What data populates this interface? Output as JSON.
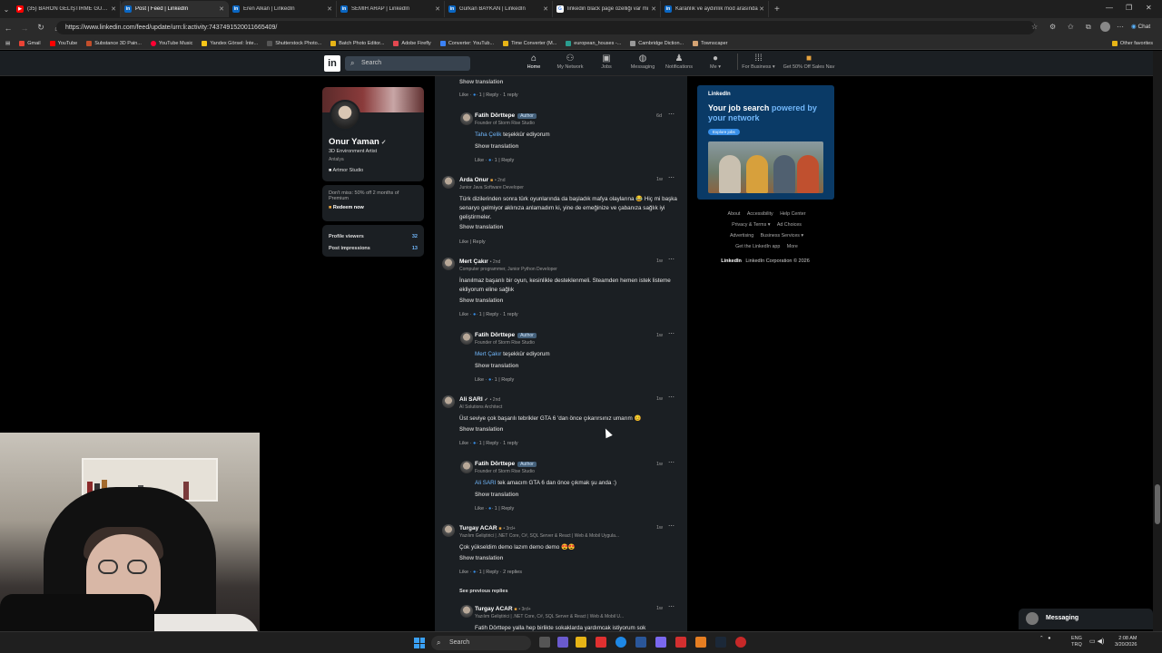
{
  "browser": {
    "tabs": [
      {
        "label": "(35) BARON GELİŞTİRME GÜNLÜĞ",
        "icon": "youtube-icon",
        "color": "#ff0000",
        "active": false
      },
      {
        "label": "Post | Feed | LinkedIn",
        "icon": "linkedin-icon",
        "color": "#0a66c2",
        "active": true
      },
      {
        "label": "Eren Alkan | LinkedIn",
        "icon": "linkedin-icon",
        "color": "#0a66c2",
        "active": false
      },
      {
        "label": "SEMİH ARAP | LinkedIn",
        "icon": "linkedin-icon",
        "color": "#0a66c2",
        "active": false
      },
      {
        "label": "Gürkan BAYKAN | LinkedIn",
        "icon": "linkedin-icon",
        "color": "#0a66c2",
        "active": false
      },
      {
        "label": "linkedin black page özelliği var mı",
        "icon": "google-icon",
        "color": "#ffffff",
        "active": false
      },
      {
        "label": "Karanlık ve aydınlık mod arasında",
        "icon": "linkedin-icon",
        "color": "#0a66c2",
        "active": false
      }
    ],
    "url": "https://www.linkedin.com/feed/update/urn:li:activity:7437491520011665409/",
    "chat_label": "Chat",
    "bookmarks": [
      "Gmail",
      "YouTube",
      "Substance 3D Pain...",
      "YouTube Music",
      "Yandex Görsel: İnte...",
      "Shutterstock Photo...",
      "Batch Photo Editor...",
      "Adobe Firefly",
      "Converter: YouTub...",
      "Time Converter (M...",
      "european_houses -...",
      "Cambridge Diction...",
      "Townscaper"
    ],
    "other_favorites": "Other favorites"
  },
  "linkedin_nav": {
    "logo": "in",
    "search_placeholder": "Search",
    "items": [
      {
        "label": "Home",
        "icon": "home-icon"
      },
      {
        "label": "My Network",
        "icon": "network-icon"
      },
      {
        "label": "Jobs",
        "icon": "briefcase-icon"
      },
      {
        "label": "Messaging",
        "icon": "message-icon"
      },
      {
        "label": "Notifications",
        "icon": "bell-icon"
      },
      {
        "label": "Me ▾",
        "icon": "avatar-icon"
      },
      {
        "label": "For Business ▾",
        "icon": "grid-icon"
      },
      {
        "label": "Get 50% Off Sales Nav",
        "icon": "sales-icon"
      }
    ]
  },
  "profile": {
    "name": "Onur Yaman",
    "title": "3D Environment Artist",
    "location": "Antalya",
    "company": "Artmor Studio",
    "premium_text": "Don't miss: 50% off 2 months of Premium",
    "redeem_label": "Redeem now",
    "stats": [
      {
        "label": "Profile viewers",
        "value": "32"
      },
      {
        "label": "Post impressions",
        "value": "13"
      }
    ]
  },
  "comments": {
    "show_translation": "Show translation",
    "like_label": "Like",
    "reply_label": "Reply",
    "author_badge": "Author",
    "c0_actions": "· 1 | Reply · 1 reply",
    "r1": {
      "name": "Fatih Dörttepe",
      "title": "Founder of Storm Rise Studio",
      "time": "6d",
      "mention": "Taha Çelik",
      "text": " teşekkür ediyorum",
      "actions": "· 1 | Reply"
    },
    "c2": {
      "name": "Arda Onur",
      "degree": "• 2nd",
      "title": "Junior Java Software Developer",
      "time": "1w",
      "text": "Türk dizilerinden sonra türk oyunlarında da başladık mafya olaylarına 😂 Hiç mi başka senaryo gelmiyor aklınıza anlamadım ki, yine de emeğinize ve çabanıza sağlık iyi geliştirmeler.",
      "actions": "| Reply"
    },
    "c3": {
      "name": "Mert Çakır",
      "degree": "• 2nd",
      "title": "Computer programmer, Junior Python Developer",
      "time": "1w",
      "text": "İnanılmaz başarılı bir oyun, kesinlikle desteklenmeli. Steamden hemen istek listeme ekliyorum eline sağlık",
      "actions": "· 1 | Reply · 1 reply"
    },
    "r4": {
      "name": "Fatih Dörttepe",
      "title": "Founder of Storm Rise Studio",
      "time": "1w",
      "mention": "Mert Çakır",
      "text": " teşekkür ediyorum",
      "actions": "· 1 | Reply"
    },
    "c5": {
      "name": "Ali SARI",
      "degree": "• 2nd",
      "title": "AI Solutions Architect",
      "time": "1w",
      "text": "Üst seviye çok başarılı tebrikler GTA 6 'dan önce çıkarırsınız umarım 😊",
      "actions": "· 1 | Reply · 1 reply"
    },
    "r6": {
      "name": "Fatih Dörttepe",
      "title": "Founder of Storm Rise Studio",
      "time": "1w",
      "mention": "Ali SARI",
      "text": " tek amacım GTA 6 dan önce çıkmak şu anda :)",
      "actions": "· 1 | Reply"
    },
    "c7": {
      "name": "Turgay ACAR",
      "degree": "• 3rd+",
      "title": "Yazılım Geliştirici | .NET Core, C#, SQL Server & React | Web & Mobil Uygula...",
      "time": "1w",
      "text": "Çok yükseldim demo lazım demo demo 😍😍",
      "actions": "· 1 | Reply · 2 replies"
    },
    "see_previous": "See previous replies",
    "r8": {
      "name": "Turgay ACAR",
      "degree": "• 3rd+",
      "title": "Yazılım Geliştirici | .NET Core, C#, SQL Server & React | Web & Mobil U...",
      "time": "1w",
      "text": "Fatih Dörttepe yalla hep birlikte sokaklarda yardımcak istiyorum sok"
    }
  },
  "ad": {
    "logo": "LinkedIn",
    "headline_a": "Your job search ",
    "headline_b": "powered by your network",
    "button": "Explore jobs"
  },
  "footer": {
    "links": [
      "About",
      "Accessibility",
      "Help Center",
      "Privacy & Terms ▾",
      "Ad Choices",
      "Advertising",
      "Business Services ▾",
      "Get the LinkedIn app",
      "More"
    ],
    "copyright_logo": "LinkedIn",
    "copyright": "LinkedIn Corporation © 2026"
  },
  "messaging_label": "Messaging",
  "taskbar": {
    "search_placeholder": "Search",
    "lang_top": "ENG",
    "lang_bottom": "TRQ",
    "time": "2:08 AM",
    "date": "3/20/2026"
  }
}
